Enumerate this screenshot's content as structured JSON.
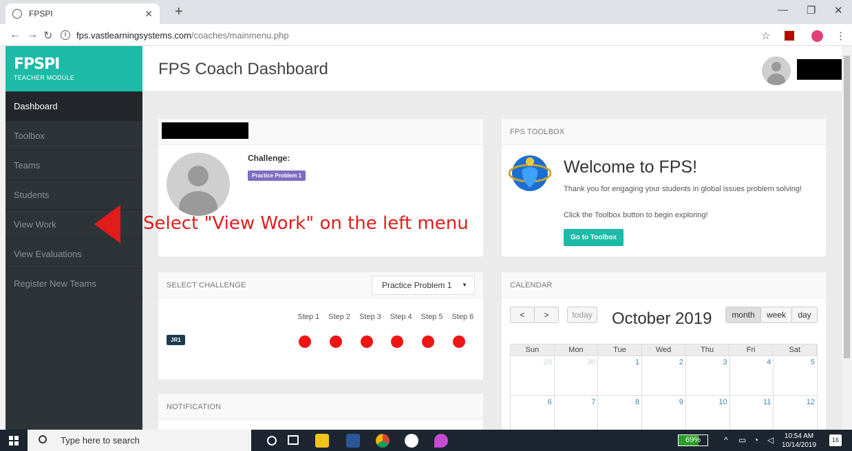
{
  "browser": {
    "tab_title": "FPSPI",
    "url_host": "fps.vastlearningsystems.com",
    "url_path": "/coaches/mainmenu.php"
  },
  "brand": {
    "logo": "FPSPI",
    "subtitle": "TEACHER MODULE"
  },
  "header": {
    "title": "FPS Coach Dashboard"
  },
  "sidebar": {
    "items": [
      {
        "label": "Dashboard",
        "active": true
      },
      {
        "label": "Toolbox"
      },
      {
        "label": "Teams"
      },
      {
        "label": "Students"
      },
      {
        "label": "View Work"
      },
      {
        "label": "View Evaluations"
      },
      {
        "label": "Register New Teams"
      }
    ]
  },
  "profile_card": {
    "challenge_label": "Challenge:",
    "challenge_badge": "Practice Problem 1"
  },
  "toolbox_card": {
    "header": "FPS TOOLBOX",
    "title": "Welcome to FPS!",
    "text1": "Thank you for engaging your students in global issues problem solving!",
    "text2": "Click the Toolbox button to begin exploring!",
    "button": "Go to Toolbox"
  },
  "select_card": {
    "header": "SELECT CHALLENGE",
    "selected": "Practice Problem 1",
    "steps": [
      "Step 1",
      "Step 2",
      "Step 3",
      "Step 4",
      "Step 5",
      "Step 6"
    ],
    "team": "JR1",
    "status_color": "#f01515"
  },
  "notification_card": {
    "header": "NOTIFICATION"
  },
  "calendar": {
    "header": "CALENDAR",
    "prev": "<",
    "next": ">",
    "today": "today",
    "title": "October 2019",
    "views": [
      "month",
      "week",
      "day"
    ],
    "days": [
      "Sun",
      "Mon",
      "Tue",
      "Wed",
      "Thu",
      "Fri",
      "Sat"
    ],
    "week1": [
      "29",
      "30",
      "1",
      "2",
      "3",
      "4",
      "5"
    ],
    "week2": [
      "6",
      "7",
      "8",
      "9",
      "10",
      "11",
      "12"
    ]
  },
  "annotation": {
    "text": "Select \"View Work\" on the left menu"
  },
  "taskbar": {
    "search_placeholder": "Type here to search",
    "battery": "69%",
    "time": "10:54 AM",
    "date": "10/14/2019",
    "notifications": "16"
  },
  "colors": {
    "accent": "#1dbaa7",
    "sidebar": "#2e3338",
    "badge": "#7e6dc1",
    "annotation": "#e21b1b"
  }
}
